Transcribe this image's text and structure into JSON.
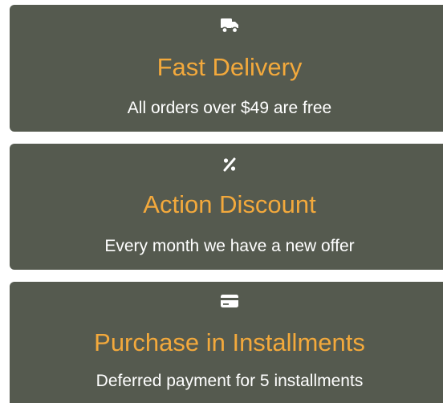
{
  "features": [
    {
      "icon": "truck-icon",
      "title": "Fast Delivery",
      "subtitle": "All orders over $49 are free"
    },
    {
      "icon": "percent-icon",
      "title": "Action Discount",
      "subtitle": "Every month we have a new offer"
    },
    {
      "icon": "credit-card-icon",
      "title": "Purchase in Installments",
      "subtitle": "Deferred payment for 5 installments"
    }
  ],
  "colors": {
    "card_background": "#555a4f",
    "title": "#f3a93c",
    "subtitle": "#ffffff",
    "icon": "#ffffff"
  }
}
